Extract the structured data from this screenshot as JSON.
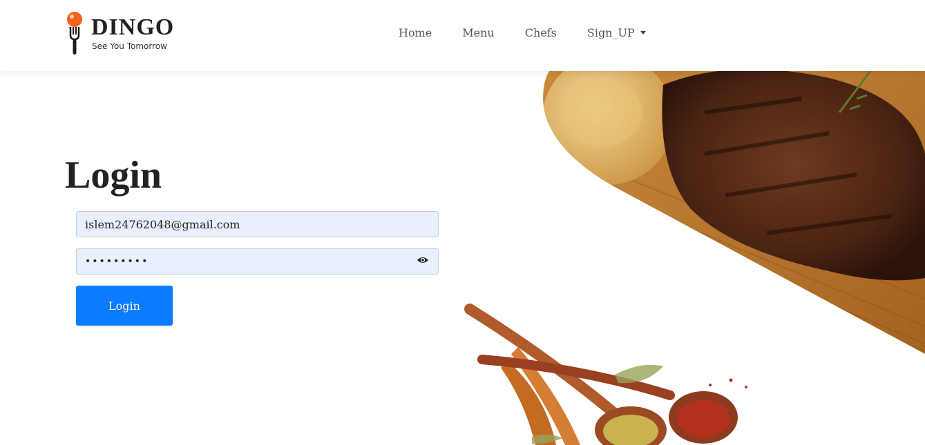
{
  "brand": {
    "name": "DINGO",
    "tagline": "See You Tomorrow",
    "icon": "fork-with-tomato-icon",
    "accent_color": "#f2641e"
  },
  "nav": {
    "items": [
      {
        "label": "Home"
      },
      {
        "label": "Menu"
      },
      {
        "label": "Chefs"
      },
      {
        "label": "Sign_UP",
        "dropdown": true
      }
    ]
  },
  "login": {
    "title": "Login",
    "email_value": "islem24762048@gmail.com",
    "password_value": "•••••••••",
    "password_toggle_icon": "eye-icon",
    "button_label": "Login",
    "button_color": "#0b7bff"
  },
  "hero": {
    "images": [
      "steak-and-potato-image",
      "spice-spoons-image"
    ]
  }
}
